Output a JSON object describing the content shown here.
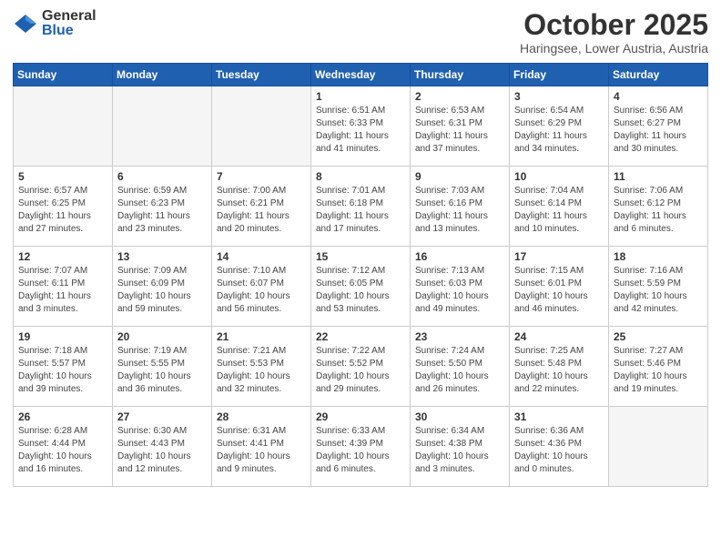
{
  "header": {
    "logo_general": "General",
    "logo_blue": "Blue",
    "month": "October 2025",
    "location": "Haringsee, Lower Austria, Austria"
  },
  "weekdays": [
    "Sunday",
    "Monday",
    "Tuesday",
    "Wednesday",
    "Thursday",
    "Friday",
    "Saturday"
  ],
  "weeks": [
    [
      {
        "day": "",
        "info": ""
      },
      {
        "day": "",
        "info": ""
      },
      {
        "day": "",
        "info": ""
      },
      {
        "day": "1",
        "info": "Sunrise: 6:51 AM\nSunset: 6:33 PM\nDaylight: 11 hours\nand 41 minutes."
      },
      {
        "day": "2",
        "info": "Sunrise: 6:53 AM\nSunset: 6:31 PM\nDaylight: 11 hours\nand 37 minutes."
      },
      {
        "day": "3",
        "info": "Sunrise: 6:54 AM\nSunset: 6:29 PM\nDaylight: 11 hours\nand 34 minutes."
      },
      {
        "day": "4",
        "info": "Sunrise: 6:56 AM\nSunset: 6:27 PM\nDaylight: 11 hours\nand 30 minutes."
      }
    ],
    [
      {
        "day": "5",
        "info": "Sunrise: 6:57 AM\nSunset: 6:25 PM\nDaylight: 11 hours\nand 27 minutes."
      },
      {
        "day": "6",
        "info": "Sunrise: 6:59 AM\nSunset: 6:23 PM\nDaylight: 11 hours\nand 23 minutes."
      },
      {
        "day": "7",
        "info": "Sunrise: 7:00 AM\nSunset: 6:21 PM\nDaylight: 11 hours\nand 20 minutes."
      },
      {
        "day": "8",
        "info": "Sunrise: 7:01 AM\nSunset: 6:18 PM\nDaylight: 11 hours\nand 17 minutes."
      },
      {
        "day": "9",
        "info": "Sunrise: 7:03 AM\nSunset: 6:16 PM\nDaylight: 11 hours\nand 13 minutes."
      },
      {
        "day": "10",
        "info": "Sunrise: 7:04 AM\nSunset: 6:14 PM\nDaylight: 11 hours\nand 10 minutes."
      },
      {
        "day": "11",
        "info": "Sunrise: 7:06 AM\nSunset: 6:12 PM\nDaylight: 11 hours\nand 6 minutes."
      }
    ],
    [
      {
        "day": "12",
        "info": "Sunrise: 7:07 AM\nSunset: 6:11 PM\nDaylight: 11 hours\nand 3 minutes."
      },
      {
        "day": "13",
        "info": "Sunrise: 7:09 AM\nSunset: 6:09 PM\nDaylight: 10 hours\nand 59 minutes."
      },
      {
        "day": "14",
        "info": "Sunrise: 7:10 AM\nSunset: 6:07 PM\nDaylight: 10 hours\nand 56 minutes."
      },
      {
        "day": "15",
        "info": "Sunrise: 7:12 AM\nSunset: 6:05 PM\nDaylight: 10 hours\nand 53 minutes."
      },
      {
        "day": "16",
        "info": "Sunrise: 7:13 AM\nSunset: 6:03 PM\nDaylight: 10 hours\nand 49 minutes."
      },
      {
        "day": "17",
        "info": "Sunrise: 7:15 AM\nSunset: 6:01 PM\nDaylight: 10 hours\nand 46 minutes."
      },
      {
        "day": "18",
        "info": "Sunrise: 7:16 AM\nSunset: 5:59 PM\nDaylight: 10 hours\nand 42 minutes."
      }
    ],
    [
      {
        "day": "19",
        "info": "Sunrise: 7:18 AM\nSunset: 5:57 PM\nDaylight: 10 hours\nand 39 minutes."
      },
      {
        "day": "20",
        "info": "Sunrise: 7:19 AM\nSunset: 5:55 PM\nDaylight: 10 hours\nand 36 minutes."
      },
      {
        "day": "21",
        "info": "Sunrise: 7:21 AM\nSunset: 5:53 PM\nDaylight: 10 hours\nand 32 minutes."
      },
      {
        "day": "22",
        "info": "Sunrise: 7:22 AM\nSunset: 5:52 PM\nDaylight: 10 hours\nand 29 minutes."
      },
      {
        "day": "23",
        "info": "Sunrise: 7:24 AM\nSunset: 5:50 PM\nDaylight: 10 hours\nand 26 minutes."
      },
      {
        "day": "24",
        "info": "Sunrise: 7:25 AM\nSunset: 5:48 PM\nDaylight: 10 hours\nand 22 minutes."
      },
      {
        "day": "25",
        "info": "Sunrise: 7:27 AM\nSunset: 5:46 PM\nDaylight: 10 hours\nand 19 minutes."
      }
    ],
    [
      {
        "day": "26",
        "info": "Sunrise: 6:28 AM\nSunset: 4:44 PM\nDaylight: 10 hours\nand 16 minutes."
      },
      {
        "day": "27",
        "info": "Sunrise: 6:30 AM\nSunset: 4:43 PM\nDaylight: 10 hours\nand 12 minutes."
      },
      {
        "day": "28",
        "info": "Sunrise: 6:31 AM\nSunset: 4:41 PM\nDaylight: 10 hours\nand 9 minutes."
      },
      {
        "day": "29",
        "info": "Sunrise: 6:33 AM\nSunset: 4:39 PM\nDaylight: 10 hours\nand 6 minutes."
      },
      {
        "day": "30",
        "info": "Sunrise: 6:34 AM\nSunset: 4:38 PM\nDaylight: 10 hours\nand 3 minutes."
      },
      {
        "day": "31",
        "info": "Sunrise: 6:36 AM\nSunset: 4:36 PM\nDaylight: 10 hours\nand 0 minutes."
      },
      {
        "day": "",
        "info": ""
      }
    ]
  ]
}
